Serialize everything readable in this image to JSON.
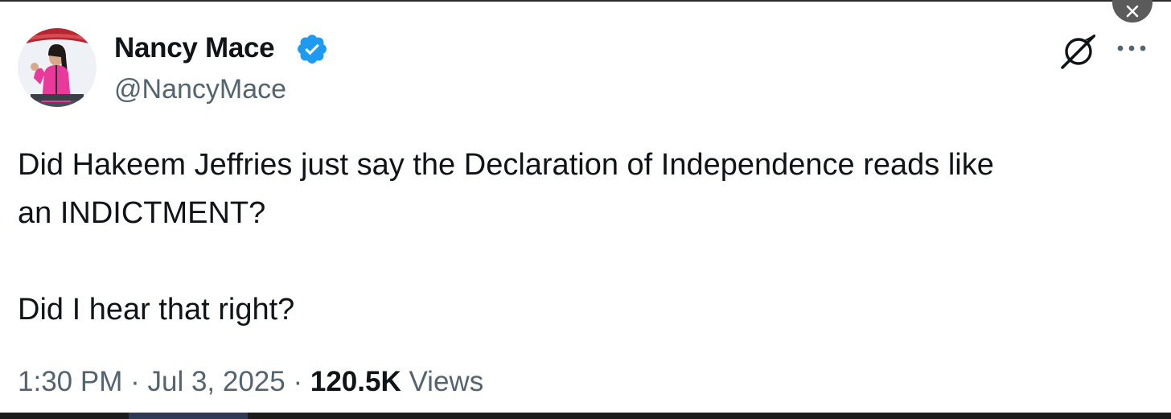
{
  "tweet": {
    "author": {
      "display_name": "Nancy Mace",
      "handle": "@NancyMace",
      "verified": true
    },
    "text_lines": [
      "Did Hakeem Jeffries just say the Declaration of Independence reads like",
      "an INDICTMENT?"
    ],
    "text_second_paragraph": "Did I hear that right?",
    "time": "1:30 PM",
    "separator": "·",
    "date": "Jul 3, 2025",
    "views_count": "120.5K",
    "views_label": "Views"
  },
  "icons": {
    "verified": "verified-badge-icon",
    "grok": "grok-icon",
    "more": "more-options-icon",
    "close": "close-icon"
  },
  "colors": {
    "primary_text": "#0f1419",
    "secondary_text": "#536471",
    "verified_blue": "#1d9bf0",
    "background": "#ffffff"
  }
}
